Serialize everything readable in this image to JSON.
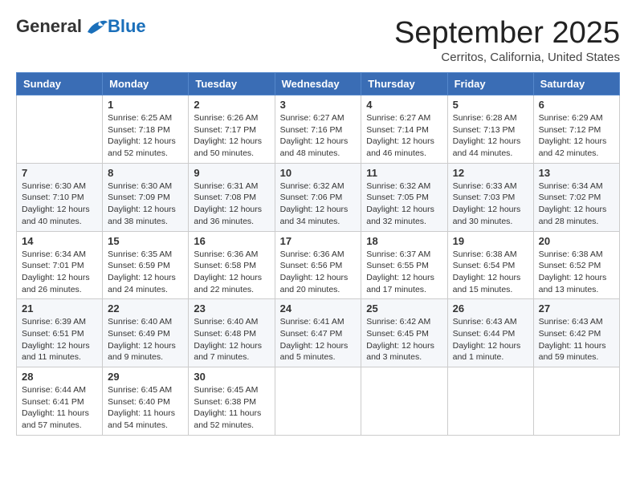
{
  "logo": {
    "general": "General",
    "blue": "Blue"
  },
  "title": "September 2025",
  "subtitle": "Cerritos, California, United States",
  "weekdays": [
    "Sunday",
    "Monday",
    "Tuesday",
    "Wednesday",
    "Thursday",
    "Friday",
    "Saturday"
  ],
  "weeks": [
    [
      {
        "day": "",
        "info": ""
      },
      {
        "day": "1",
        "info": "Sunrise: 6:25 AM\nSunset: 7:18 PM\nDaylight: 12 hours\nand 52 minutes."
      },
      {
        "day": "2",
        "info": "Sunrise: 6:26 AM\nSunset: 7:17 PM\nDaylight: 12 hours\nand 50 minutes."
      },
      {
        "day": "3",
        "info": "Sunrise: 6:27 AM\nSunset: 7:16 PM\nDaylight: 12 hours\nand 48 minutes."
      },
      {
        "day": "4",
        "info": "Sunrise: 6:27 AM\nSunset: 7:14 PM\nDaylight: 12 hours\nand 46 minutes."
      },
      {
        "day": "5",
        "info": "Sunrise: 6:28 AM\nSunset: 7:13 PM\nDaylight: 12 hours\nand 44 minutes."
      },
      {
        "day": "6",
        "info": "Sunrise: 6:29 AM\nSunset: 7:12 PM\nDaylight: 12 hours\nand 42 minutes."
      }
    ],
    [
      {
        "day": "7",
        "info": "Sunrise: 6:30 AM\nSunset: 7:10 PM\nDaylight: 12 hours\nand 40 minutes."
      },
      {
        "day": "8",
        "info": "Sunrise: 6:30 AM\nSunset: 7:09 PM\nDaylight: 12 hours\nand 38 minutes."
      },
      {
        "day": "9",
        "info": "Sunrise: 6:31 AM\nSunset: 7:08 PM\nDaylight: 12 hours\nand 36 minutes."
      },
      {
        "day": "10",
        "info": "Sunrise: 6:32 AM\nSunset: 7:06 PM\nDaylight: 12 hours\nand 34 minutes."
      },
      {
        "day": "11",
        "info": "Sunrise: 6:32 AM\nSunset: 7:05 PM\nDaylight: 12 hours\nand 32 minutes."
      },
      {
        "day": "12",
        "info": "Sunrise: 6:33 AM\nSunset: 7:03 PM\nDaylight: 12 hours\nand 30 minutes."
      },
      {
        "day": "13",
        "info": "Sunrise: 6:34 AM\nSunset: 7:02 PM\nDaylight: 12 hours\nand 28 minutes."
      }
    ],
    [
      {
        "day": "14",
        "info": "Sunrise: 6:34 AM\nSunset: 7:01 PM\nDaylight: 12 hours\nand 26 minutes."
      },
      {
        "day": "15",
        "info": "Sunrise: 6:35 AM\nSunset: 6:59 PM\nDaylight: 12 hours\nand 24 minutes."
      },
      {
        "day": "16",
        "info": "Sunrise: 6:36 AM\nSunset: 6:58 PM\nDaylight: 12 hours\nand 22 minutes."
      },
      {
        "day": "17",
        "info": "Sunrise: 6:36 AM\nSunset: 6:56 PM\nDaylight: 12 hours\nand 20 minutes."
      },
      {
        "day": "18",
        "info": "Sunrise: 6:37 AM\nSunset: 6:55 PM\nDaylight: 12 hours\nand 17 minutes."
      },
      {
        "day": "19",
        "info": "Sunrise: 6:38 AM\nSunset: 6:54 PM\nDaylight: 12 hours\nand 15 minutes."
      },
      {
        "day": "20",
        "info": "Sunrise: 6:38 AM\nSunset: 6:52 PM\nDaylight: 12 hours\nand 13 minutes."
      }
    ],
    [
      {
        "day": "21",
        "info": "Sunrise: 6:39 AM\nSunset: 6:51 PM\nDaylight: 12 hours\nand 11 minutes."
      },
      {
        "day": "22",
        "info": "Sunrise: 6:40 AM\nSunset: 6:49 PM\nDaylight: 12 hours\nand 9 minutes."
      },
      {
        "day": "23",
        "info": "Sunrise: 6:40 AM\nSunset: 6:48 PM\nDaylight: 12 hours\nand 7 minutes."
      },
      {
        "day": "24",
        "info": "Sunrise: 6:41 AM\nSunset: 6:47 PM\nDaylight: 12 hours\nand 5 minutes."
      },
      {
        "day": "25",
        "info": "Sunrise: 6:42 AM\nSunset: 6:45 PM\nDaylight: 12 hours\nand 3 minutes."
      },
      {
        "day": "26",
        "info": "Sunrise: 6:43 AM\nSunset: 6:44 PM\nDaylight: 12 hours\nand 1 minute."
      },
      {
        "day": "27",
        "info": "Sunrise: 6:43 AM\nSunset: 6:42 PM\nDaylight: 11 hours\nand 59 minutes."
      }
    ],
    [
      {
        "day": "28",
        "info": "Sunrise: 6:44 AM\nSunset: 6:41 PM\nDaylight: 11 hours\nand 57 minutes."
      },
      {
        "day": "29",
        "info": "Sunrise: 6:45 AM\nSunset: 6:40 PM\nDaylight: 11 hours\nand 54 minutes."
      },
      {
        "day": "30",
        "info": "Sunrise: 6:45 AM\nSunset: 6:38 PM\nDaylight: 11 hours\nand 52 minutes."
      },
      {
        "day": "",
        "info": ""
      },
      {
        "day": "",
        "info": ""
      },
      {
        "day": "",
        "info": ""
      },
      {
        "day": "",
        "info": ""
      }
    ]
  ]
}
